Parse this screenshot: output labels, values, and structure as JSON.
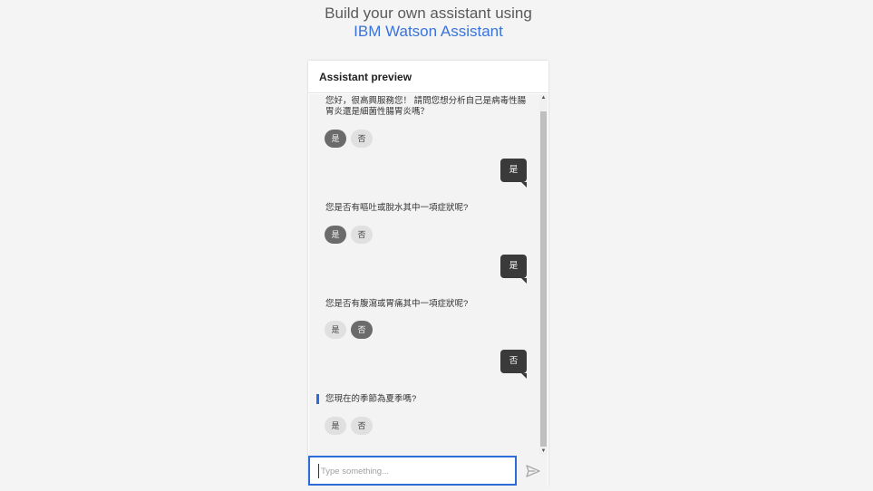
{
  "heading": {
    "line1": "Build your own assistant using",
    "line2": "IBM Watson Assistant"
  },
  "panel": {
    "title": "Assistant preview"
  },
  "conversation": [
    {
      "type": "bot",
      "text": "您好，很高興服務您！ 請問您想分析自己是病毒性腸胃炎還是細菌性腸胃炎嗎？",
      "options": [
        "是",
        "否"
      ],
      "selected": 0
    },
    {
      "type": "user",
      "text": "是"
    },
    {
      "type": "bot",
      "text": "您是否有嘔吐或脫水其中一項症狀呢?",
      "options": [
        "是",
        "否"
      ],
      "selected": 0
    },
    {
      "type": "user",
      "text": "是"
    },
    {
      "type": "bot",
      "text": "您是否有腹瀉或胃痛其中一項症狀呢?",
      "options": [
        "是",
        "否"
      ],
      "selected": 1
    },
    {
      "type": "user",
      "text": "否"
    },
    {
      "type": "bot",
      "text": "您現在的季節為夏季嗎?",
      "options": [
        "是",
        "否"
      ],
      "selected": null
    }
  ],
  "input": {
    "placeholder": "Type something...",
    "value": ""
  },
  "icons": {
    "send": "send-icon",
    "scroll_up": "scroll-up-arrow-icon",
    "scroll_down": "scroll-down-arrow-icon"
  },
  "colors": {
    "accent": "#3b73d9",
    "user_bubble": "#3a3a3a",
    "selected_option": "#6b6b6b",
    "option": "#e0e0e0"
  }
}
